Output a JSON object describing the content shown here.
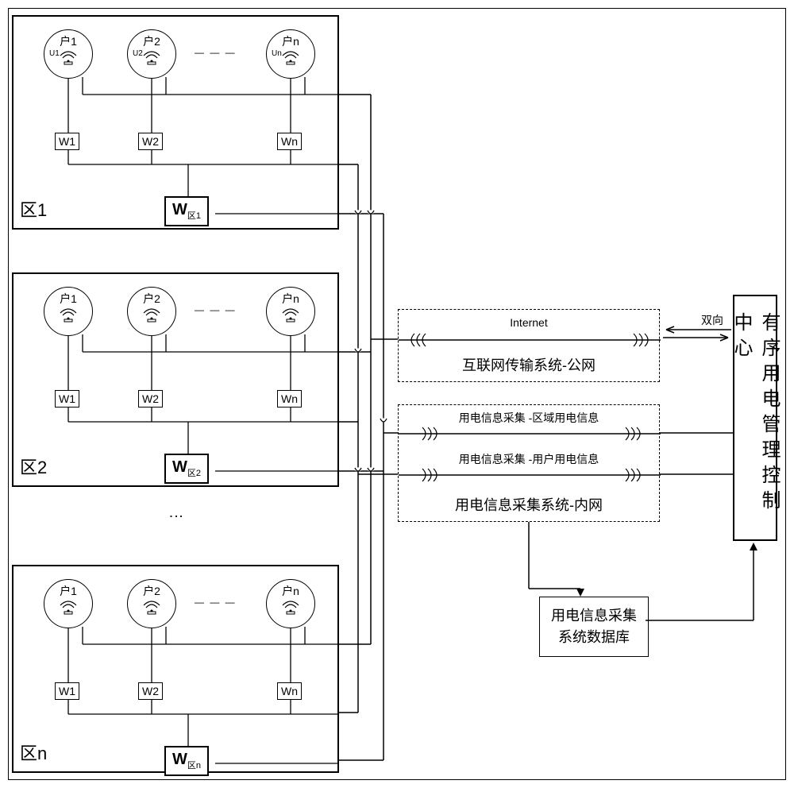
{
  "zones": [
    {
      "id": 1,
      "label": "区1",
      "meter": "W<sub>区1</sub>"
    },
    {
      "id": 2,
      "label": "区2",
      "meter": "W<sub>区2</sub>"
    },
    {
      "id": 3,
      "label": "区n",
      "meter": "W<sub>区n</sub>"
    }
  ],
  "houses": [
    {
      "top": "户1",
      "sub": "U1",
      "meter": "W1"
    },
    {
      "top": "户2",
      "sub": "U2",
      "meter": "W2"
    },
    {
      "top": "户n",
      "sub": "Un",
      "meter": "Wn"
    }
  ],
  "internet_label": "Internet",
  "public_net": "互联网传输系统-公网",
  "info_region": "用电信息采集 -区域用电信息",
  "info_user": "用电信息采集 -用户用电信息",
  "private_net": "用电信息采集系统-内网",
  "database": {
    "line1": "用电信息采集",
    "line2": "系统数据库"
  },
  "control": "有序用电管理控制中心",
  "bidirectional": "双向",
  "vertical_dots": "⋮"
}
